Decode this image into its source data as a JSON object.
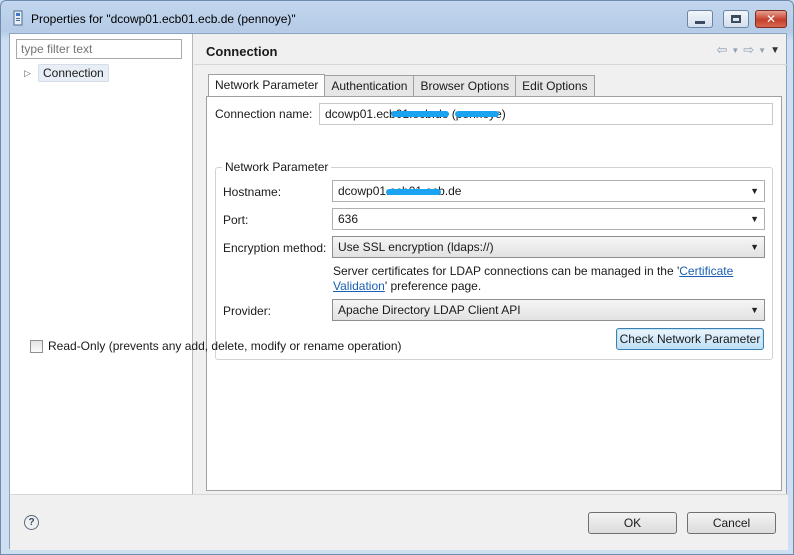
{
  "window": {
    "title": "Properties for \"dcowp01.ecb01.ecb.de (pennoye)\"",
    "icon": "ldap-properties-icon"
  },
  "left_pane": {
    "filter_placeholder": "type filter text",
    "tree": [
      {
        "label": "Connection",
        "expanded": false,
        "selected": true
      }
    ]
  },
  "page": {
    "title": "Connection",
    "tabs": [
      {
        "label": "Network Parameter",
        "active": true
      },
      {
        "label": "Authentication",
        "active": false
      },
      {
        "label": "Browser Options",
        "active": false
      },
      {
        "label": "Edit Options",
        "active": false
      }
    ],
    "connection_name_label": "Connection name:",
    "connection_name_value": "dcowp01.ecb01.ecb.de (pennoye)",
    "group_title": "Network Parameter",
    "hostname_label": "Hostname:",
    "hostname_value": "dcowp01.ecb01.ecb.de",
    "port_label": "Port:",
    "port_value": "636",
    "encryption_label": "Encryption method:",
    "encryption_value": "Use SSL encryption (ldaps://)",
    "note_text_1": "Server certificates for LDAP connections can be managed in the '",
    "note_link_1": "Certificate",
    "note_link_2": "Validation",
    "note_text_2": "' preference page.",
    "provider_label": "Provider:",
    "provider_value": "Apache Directory LDAP Client API",
    "check_button": "Check Network Parameter",
    "readonly_label": "Read-Only (prevents any add, delete, modify or rename operation)",
    "readonly_checked": false
  },
  "buttons": {
    "ok": "OK",
    "cancel": "Cancel"
  },
  "colors": {
    "accent": "#1a5fb4",
    "redaction": "#1aa3f0"
  }
}
